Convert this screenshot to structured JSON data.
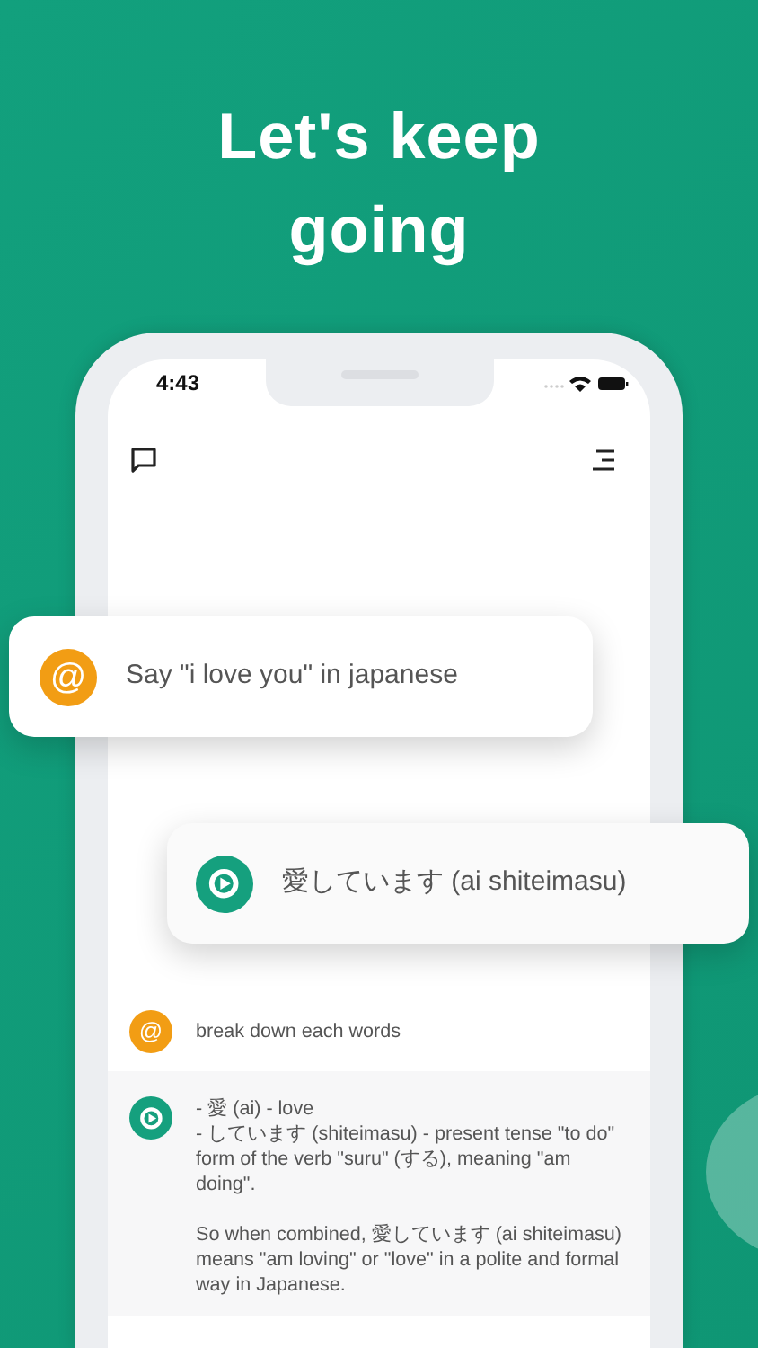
{
  "headline": [
    "Let's keep",
    "going"
  ],
  "status_bar": {
    "time": "4:43"
  },
  "floating_messages": [
    {
      "kind": "user",
      "avatar_symbol": "@",
      "text": "Say \"i love you\" in japanese"
    },
    {
      "kind": "bot",
      "text": "愛しています (ai shiteimasu)"
    }
  ],
  "chat": {
    "messages": [
      {
        "kind": "user",
        "avatar_symbol": "@",
        "paragraphs": [
          "break down each words"
        ]
      },
      {
        "kind": "bot",
        "paragraphs": [
          "- 愛 (ai) - love",
          "- しています (shiteimasu) - present tense \"to do\" form of the verb \"suru\" (する), meaning \"am doing\".",
          "So when combined, 愛しています (ai shiteimasu) means \"am loving\" or \"love\" in a polite and formal way in Japanese."
        ]
      }
    ]
  }
}
